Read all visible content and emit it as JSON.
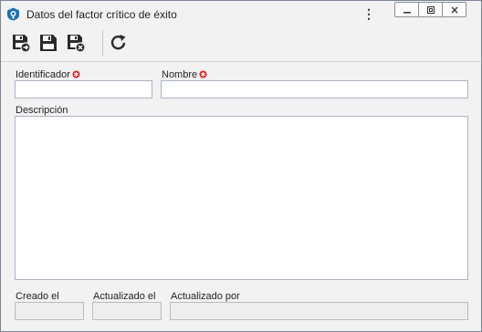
{
  "window": {
    "title": "Datos del factor crítico de éxito",
    "kebab_glyph": "⋮"
  },
  "toolbar": {
    "buttons": [
      "save-and-new",
      "save",
      "save-and-close",
      "refresh"
    ]
  },
  "form": {
    "identificador_label": "Identificador",
    "identificador_value": "",
    "nombre_label": "Nombre",
    "nombre_value": "",
    "descripcion_label": "Descripción",
    "descripcion_value": "",
    "creado_label": "Creado el",
    "creado_value": "",
    "actualizado_el_label": "Actualizado el",
    "actualizado_el_value": "",
    "actualizado_por_label": "Actualizado por",
    "actualizado_por_value": ""
  },
  "colors": {
    "required_marker": "#d9252a",
    "field_border": "#a9b4c2",
    "readonly_bg": "#eeeeee",
    "window_bg": "#f2f2f2"
  }
}
